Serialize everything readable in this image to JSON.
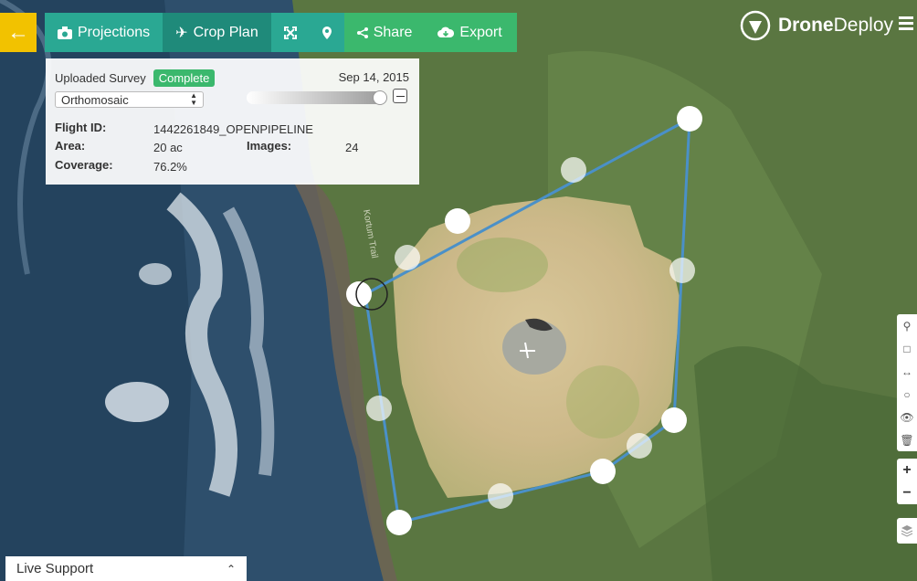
{
  "app": {
    "brand_bold": "Drone",
    "brand_light": "Deploy"
  },
  "toolbar": {
    "back_icon": "arrow-left-icon",
    "projections_label": "Projections",
    "crop_plan_label": "Crop Plan",
    "share_label": "Share",
    "export_label": "Export"
  },
  "survey": {
    "source_label": "Uploaded Survey",
    "status": "Complete",
    "date": "Sep 14, 2015",
    "layer_selected": "Orthomosaic",
    "opacity": 1.0,
    "flight_id_label": "Flight ID:",
    "flight_id": "1442261849_OPENPIPELINE",
    "area_label": "Area:",
    "area": "20 ac",
    "images_label": "Images:",
    "images": "24",
    "coverage_label": "Coverage:",
    "coverage": "76.2%"
  },
  "map_labels": {
    "trail": "Kortum Trail"
  },
  "zoom": {
    "in_label": "+",
    "out_label": "−"
  },
  "live_support": {
    "label": "Live Support"
  },
  "colors": {
    "teal": "#2aa893",
    "green": "#3bb86d",
    "yellow": "#f2c200",
    "polygon": "#4a90c8"
  }
}
